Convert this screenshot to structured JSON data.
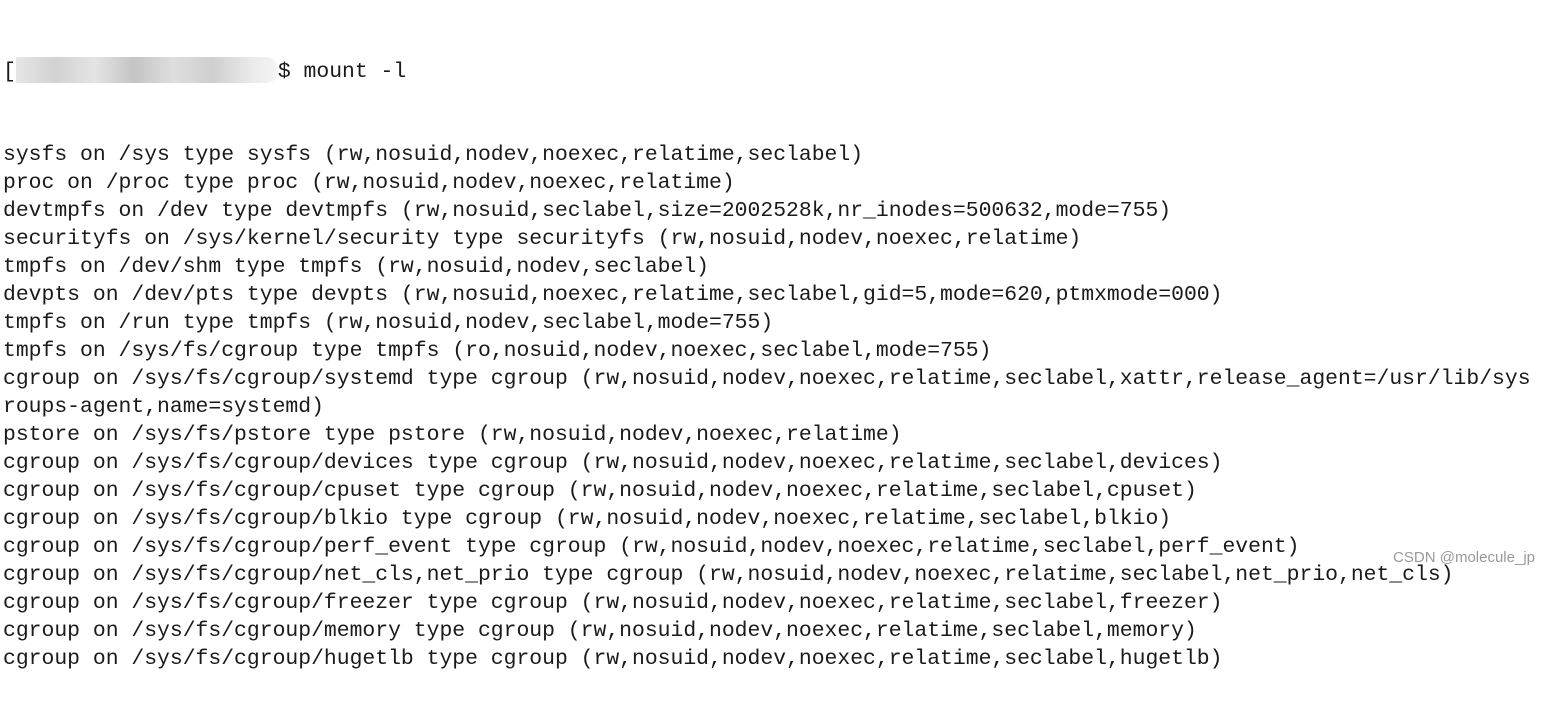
{
  "prompt": {
    "open_bracket": "[",
    "command": "$ mount -l"
  },
  "output_lines": [
    "sysfs on /sys type sysfs (rw,nosuid,nodev,noexec,relatime,seclabel)",
    "proc on /proc type proc (rw,nosuid,nodev,noexec,relatime)",
    "devtmpfs on /dev type devtmpfs (rw,nosuid,seclabel,size=2002528k,nr_inodes=500632,mode=755)",
    "securityfs on /sys/kernel/security type securityfs (rw,nosuid,nodev,noexec,relatime)",
    "tmpfs on /dev/shm type tmpfs (rw,nosuid,nodev,seclabel)",
    "devpts on /dev/pts type devpts (rw,nosuid,noexec,relatime,seclabel,gid=5,mode=620,ptmxmode=000)",
    "tmpfs on /run type tmpfs (rw,nosuid,nodev,seclabel,mode=755)",
    "tmpfs on /sys/fs/cgroup type tmpfs (ro,nosuid,nodev,noexec,seclabel,mode=755)",
    "cgroup on /sys/fs/cgroup/systemd type cgroup (rw,nosuid,nodev,noexec,relatime,seclabel,xattr,release_agent=/usr/lib/sys",
    "roups-agent,name=systemd)",
    "pstore on /sys/fs/pstore type pstore (rw,nosuid,nodev,noexec,relatime)",
    "cgroup on /sys/fs/cgroup/devices type cgroup (rw,nosuid,nodev,noexec,relatime,seclabel,devices)",
    "cgroup on /sys/fs/cgroup/cpuset type cgroup (rw,nosuid,nodev,noexec,relatime,seclabel,cpuset)",
    "cgroup on /sys/fs/cgroup/blkio type cgroup (rw,nosuid,nodev,noexec,relatime,seclabel,blkio)",
    "cgroup on /sys/fs/cgroup/perf_event type cgroup (rw,nosuid,nodev,noexec,relatime,seclabel,perf_event)",
    "cgroup on /sys/fs/cgroup/net_cls,net_prio type cgroup (rw,nosuid,nodev,noexec,relatime,seclabel,net_prio,net_cls)",
    "cgroup on /sys/fs/cgroup/freezer type cgroup (rw,nosuid,nodev,noexec,relatime,seclabel,freezer)",
    "cgroup on /sys/fs/cgroup/memory type cgroup (rw,nosuid,nodev,noexec,relatime,seclabel,memory)",
    "cgroup on /sys/fs/cgroup/hugetlb type cgroup (rw,nosuid,nodev,noexec,relatime,seclabel,hugetlb)"
  ],
  "watermark": "CSDN @molecule_jp"
}
